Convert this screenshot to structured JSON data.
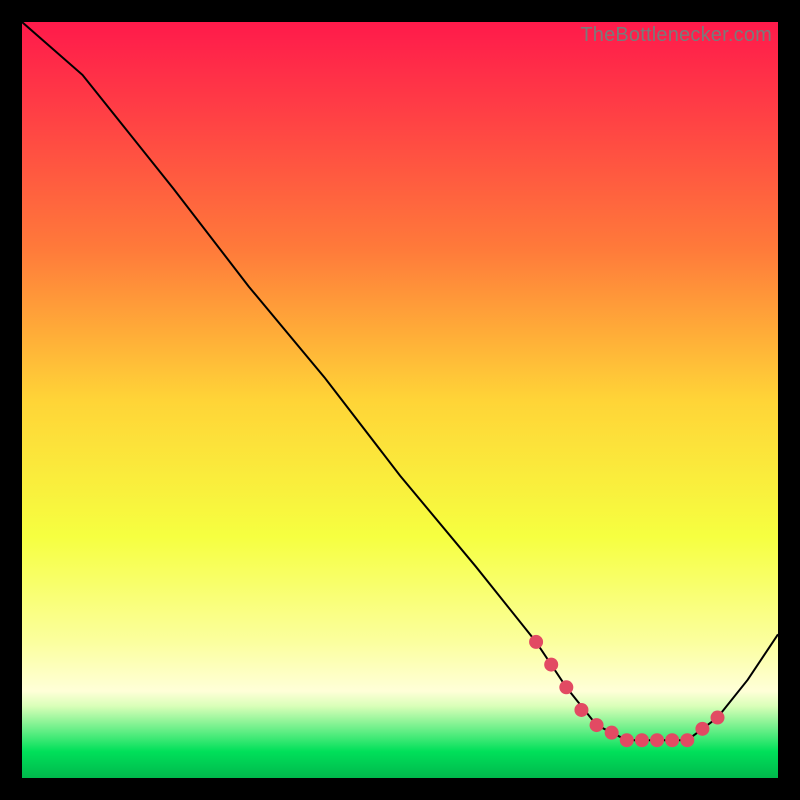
{
  "watermark": "TheBottlenecker.com",
  "chart_data": {
    "type": "line",
    "title": "",
    "xlabel": "",
    "ylabel": "",
    "xlim": [
      0,
      100
    ],
    "ylim": [
      0,
      100
    ],
    "background_gradient": {
      "stops": [
        {
          "offset": 0.0,
          "color": "#ff1a4b"
        },
        {
          "offset": 0.12,
          "color": "#ff3f45"
        },
        {
          "offset": 0.3,
          "color": "#ff7a3a"
        },
        {
          "offset": 0.5,
          "color": "#ffd437"
        },
        {
          "offset": 0.68,
          "color": "#f6ff40"
        },
        {
          "offset": 0.82,
          "color": "#fbff9e"
        },
        {
          "offset": 0.885,
          "color": "#ffffd8"
        },
        {
          "offset": 0.905,
          "color": "#d9ffb8"
        },
        {
          "offset": 0.965,
          "color": "#00e05a"
        },
        {
          "offset": 1.0,
          "color": "#00b84c"
        }
      ]
    },
    "series": [
      {
        "name": "bottleneck-curve",
        "color": "#000000",
        "stroke_width": 2,
        "x": [
          0,
          8,
          20,
          30,
          40,
          50,
          60,
          68,
          72,
          76,
          80,
          84,
          88,
          92,
          96,
          100
        ],
        "values": [
          100,
          93,
          78,
          65,
          53,
          40,
          28,
          18,
          12,
          7,
          5,
          5,
          5,
          8,
          13,
          19
        ]
      }
    ],
    "markers": {
      "name": "optimal-range-dots",
      "color": "#e24a63",
      "radius": 7,
      "x": [
        68,
        70,
        72,
        74,
        76,
        78,
        80,
        82,
        84,
        86,
        88,
        90,
        92
      ],
      "values": [
        18,
        15,
        12,
        9,
        7,
        6,
        5,
        5,
        5,
        5,
        5,
        6.5,
        8
      ]
    }
  }
}
